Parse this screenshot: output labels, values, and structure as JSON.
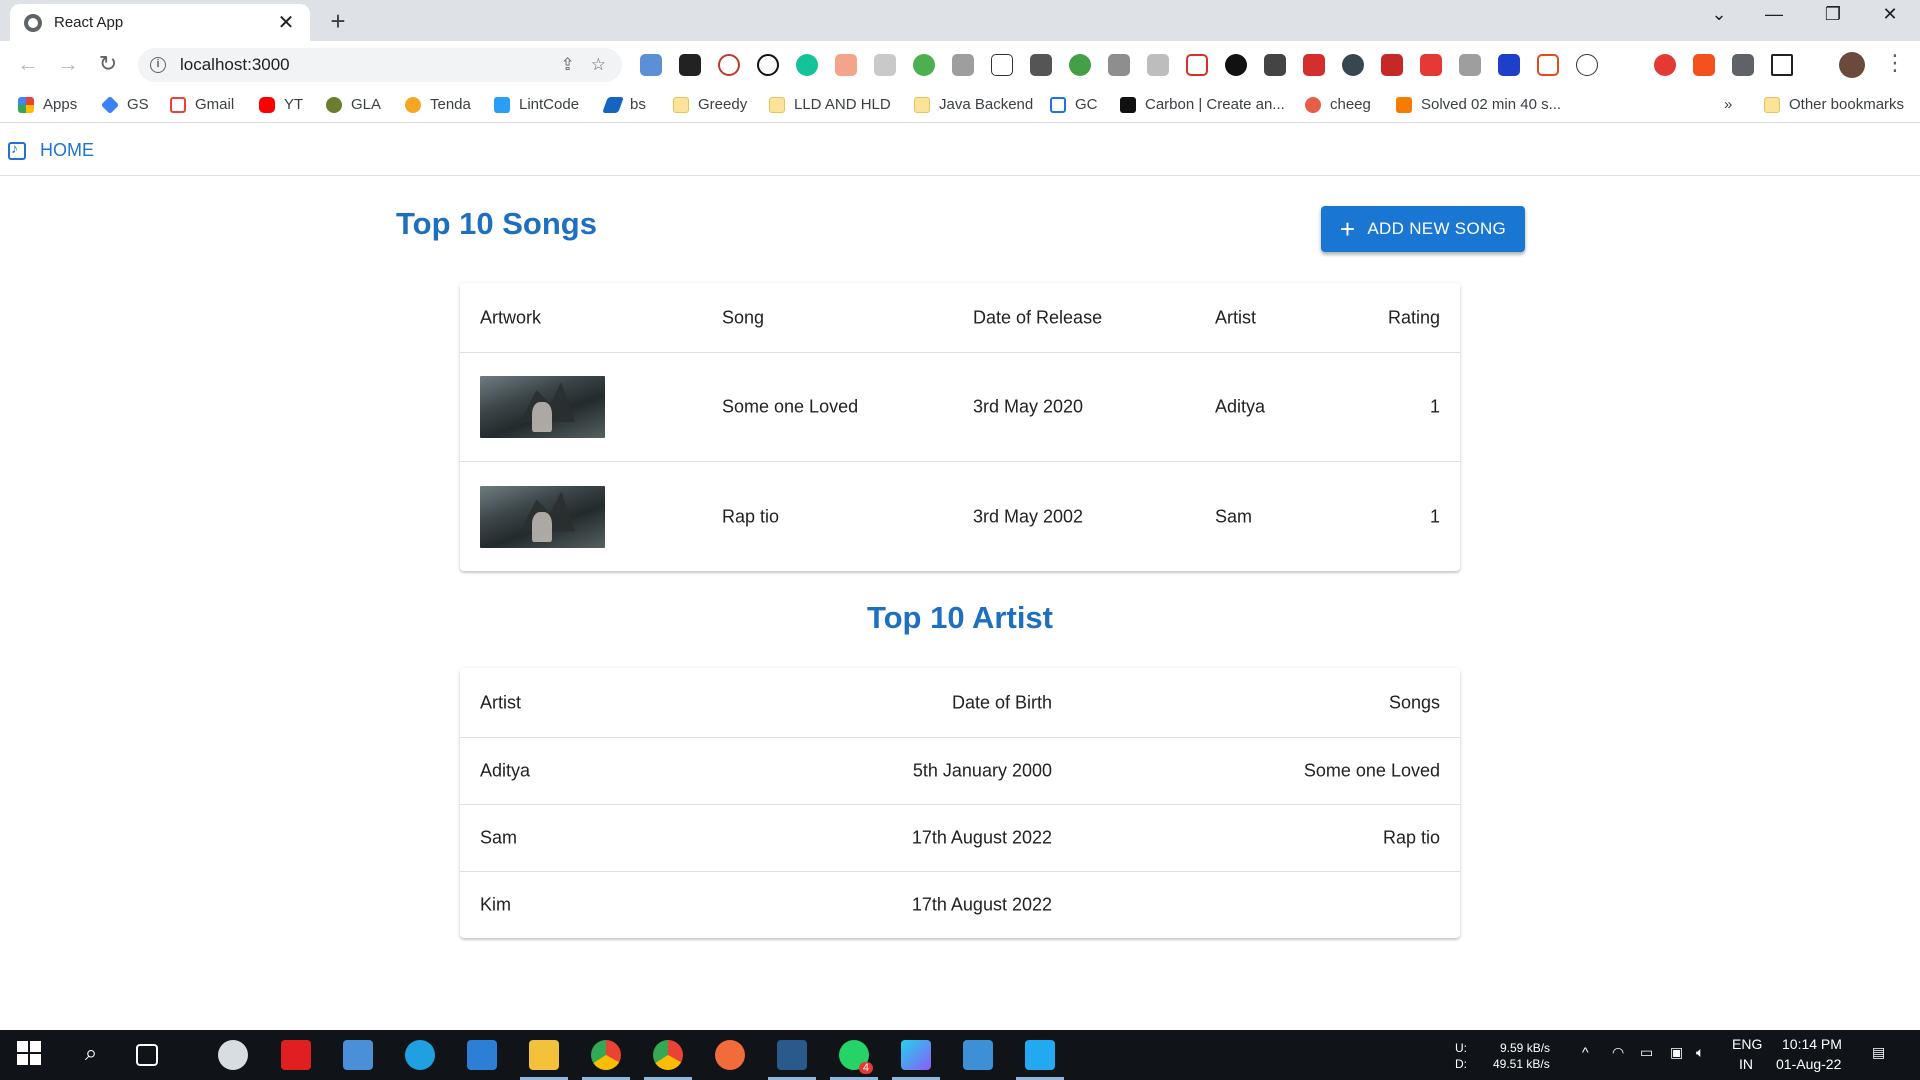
{
  "browser": {
    "tab_title": "React App",
    "url": "localhost:3000",
    "bookmarks": [
      "Apps",
      "GS",
      "Gmail",
      "YT",
      "GLA",
      "Tenda",
      "LintCode",
      "bs",
      "Greedy",
      "LLD AND HLD",
      "Java Backend",
      "GC",
      "Carbon | Create an...",
      "cheeg",
      "Solved 02 min 40 s...",
      "»",
      "Other bookmarks"
    ]
  },
  "nav": {
    "home_label": "HOME"
  },
  "songs": {
    "title": "Top 10 Songs",
    "add_button": "ADD NEW SONG",
    "headers": [
      "Artwork",
      "Song",
      "Date of Release",
      "Artist",
      "Rating"
    ],
    "rows": [
      {
        "song": "Some one Loved",
        "date": "3rd May 2020",
        "artist": "Aditya",
        "rating": "1"
      },
      {
        "song": "Rap tio",
        "date": "3rd May 2002",
        "artist": "Sam",
        "rating": "1"
      }
    ]
  },
  "artists": {
    "title": "Top 10 Artist",
    "headers": [
      "Artist",
      "Date of Birth",
      "Songs"
    ],
    "rows": [
      {
        "artist": "Aditya",
        "dob": "5th January 2000",
        "songs": "Some one Loved"
      },
      {
        "artist": "Sam",
        "dob": "17th August 2022",
        "songs": "Rap tio"
      },
      {
        "artist": "Kim",
        "dob": "17th August 2022",
        "songs": ""
      }
    ]
  },
  "taskbar": {
    "upload_label": "U:",
    "download_label": "D:",
    "upload_speed": "9.59 kB/s",
    "download_speed": "49.51 kB/s",
    "lang": "ENG",
    "region": "IN",
    "time": "10:14 PM",
    "date": "01-Aug-22",
    "whatsapp_badge": "4"
  },
  "colors": {
    "primary": "#1976d2",
    "title": "#1e6fc0"
  }
}
